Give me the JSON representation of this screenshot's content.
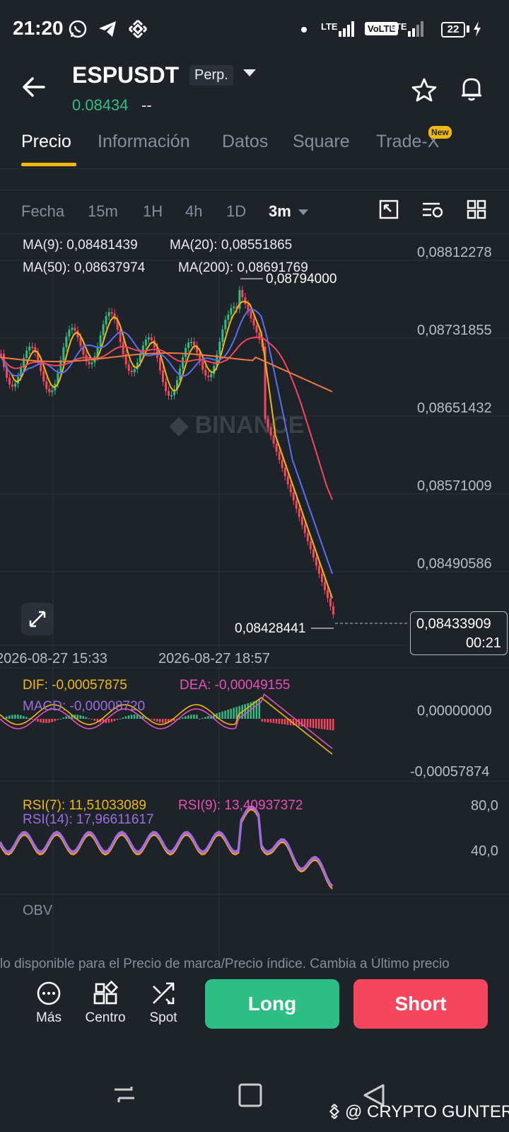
{
  "status_bar": {
    "time": "21:20",
    "signal1": "LTE",
    "volte": "VoLTE",
    "signal2": "LTE",
    "battery": "22",
    "icons": [
      "whatsapp-icon",
      "telegram-icon",
      "binance-icon"
    ]
  },
  "header": {
    "pair": "ESPUSDT",
    "contract_type": "Perp.",
    "last_price": "0.08434",
    "change": "--"
  },
  "tabs": [
    {
      "label": "Precio",
      "active": true
    },
    {
      "label": "Información"
    },
    {
      "label": "Datos"
    },
    {
      "label": "Square"
    },
    {
      "label": "Trade-X",
      "badge": "New"
    }
  ],
  "intervals": {
    "date": "Fecha",
    "items": [
      "15m",
      "1H",
      "4h",
      "1D"
    ],
    "selected": "3m"
  },
  "main_chart": {
    "ma9": "MA(9): 0,08481439",
    "ma20": "MA(20): 0,08551865",
    "ma50": "MA(50): 0,08637974",
    "ma200": "MA(200): 0,08691769",
    "y_ticks": [
      "0,08812278",
      "0,08731855",
      "0,08651432",
      "0,08571009",
      "0,08490586"
    ],
    "high_label": "0,08794000",
    "low_label": "0,08428441",
    "current_price": "0,08433909",
    "countdown": "00:21",
    "x_ticks": [
      "2026-08-27 15:33",
      "2026-08-27 18:57"
    ],
    "colors": {
      "up": "#2ebd85",
      "down": "#f6465d",
      "ma9": "#f0b90b",
      "ma20": "#5a6ef0",
      "ma50": "#f6465d",
      "ma200": "#ee7a44"
    }
  },
  "macd": {
    "dif": "DIF: -0,00057875",
    "dea": "DEA: -0,00049155",
    "macd": "MACD: -0,00008720",
    "y_ticks": [
      "0,00000000",
      "-0,00057874"
    ],
    "colors": {
      "dif": "#f0b90b",
      "dea": "#e84fb5",
      "macd": "#9b6ede"
    }
  },
  "rsi": {
    "rsi7": "RSI(7): 11,51033089",
    "rsi9": "RSI(9): 13,40937372",
    "rsi14": "RSI(14): 17,96611617",
    "y_ticks": [
      "80,0",
      "40,0"
    ],
    "colors": {
      "rsi7": "#f0b90b",
      "rsi9": "#e84fb5",
      "rsi14": "#9b6ede"
    }
  },
  "obv_label": "OBV",
  "banner": "lo disponible para el Precio de marca/Precio índice. Cambia a Último precio",
  "bottom_bar": {
    "more": "Más",
    "center": "Centro",
    "spot": "Spot",
    "long": "Long",
    "short": "Short"
  },
  "watermark": "@ CRYPTO GUNTER"
}
